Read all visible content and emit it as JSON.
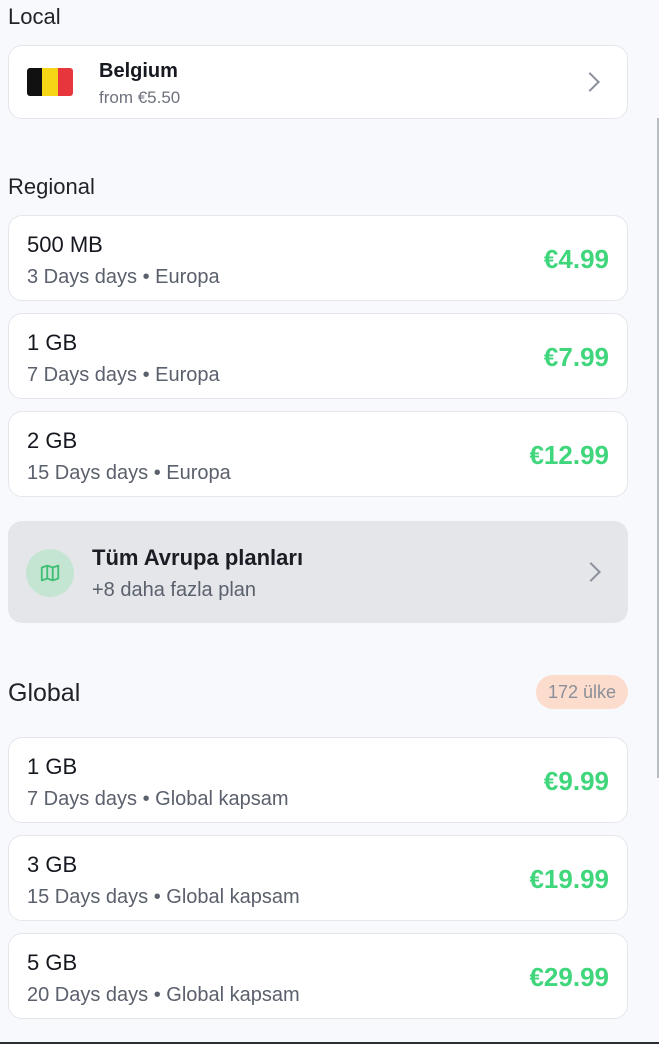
{
  "local": {
    "title": "Local",
    "country": "Belgium",
    "from_price": "from €5.50",
    "flag_colors": [
      "#111111",
      "#f5d515",
      "#e8373c"
    ]
  },
  "regional": {
    "title": "Regional",
    "plans": [
      {
        "data": "500 MB",
        "detail": "3 Days days • Europa",
        "price": "€4.99"
      },
      {
        "data": "1 GB",
        "detail": "7 Days days • Europa",
        "price": "€7.99"
      },
      {
        "data": "2 GB",
        "detail": "15 Days days • Europa",
        "price": "€12.99"
      }
    ],
    "more_title": "Tüm Avrupa planları",
    "more_sub": "+8 daha fazla plan"
  },
  "global": {
    "title": "Global",
    "badge": "172 ülke",
    "plans": [
      {
        "data": "1 GB",
        "detail": "7 Days days • Global kapsam",
        "price": "€9.99"
      },
      {
        "data": "3 GB",
        "detail": "15 Days days • Global kapsam",
        "price": "€19.99"
      },
      {
        "data": "5 GB",
        "detail": "20 Days days • Global kapsam",
        "price": "€29.99"
      }
    ]
  },
  "colors": {
    "price": "#3fd67c",
    "badge_bg": "#fbdccd",
    "more_bg": "#e5e6ea"
  }
}
